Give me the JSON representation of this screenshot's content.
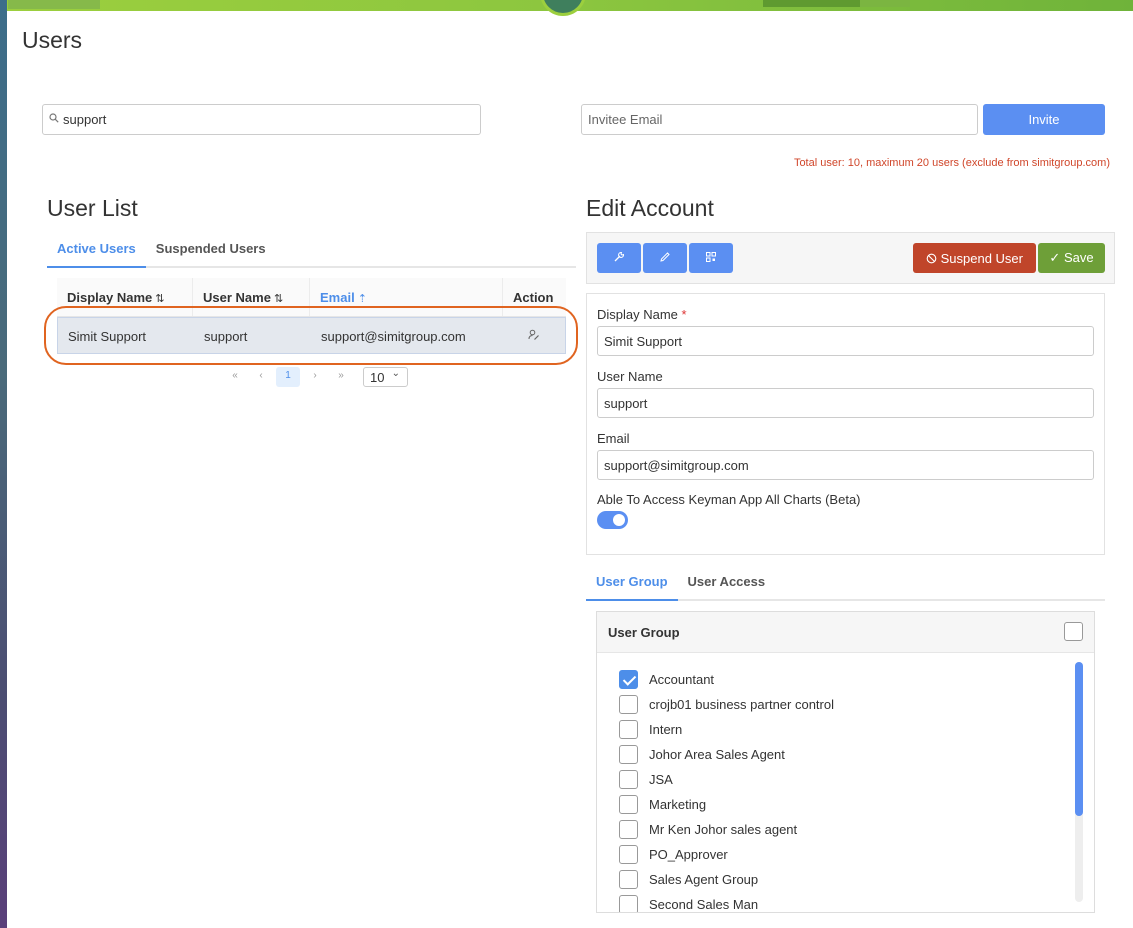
{
  "page": {
    "title": "Users"
  },
  "search": {
    "value": "support",
    "placeholder": "Search"
  },
  "invite": {
    "placeholder": "Invitee Email",
    "button_label": "Invite"
  },
  "total_note": "Total user: 10, maximum 20 users (exclude from simitgroup.com)",
  "user_list": {
    "title": "User List",
    "tabs": [
      {
        "label": "Active Users"
      },
      {
        "label": "Suspended Users"
      }
    ],
    "columns": [
      "Display Name",
      "User Name",
      "Email",
      "Action"
    ],
    "rows": [
      {
        "display_name": "Simit Support",
        "user_name": "support",
        "email": "support@simitgroup.com",
        "action_icon": "user-edit-icon"
      }
    ],
    "pagination": {
      "first": "«",
      "prev": "‹",
      "current": "1",
      "next": "›",
      "last": "»",
      "page_size": "10"
    }
  },
  "edit_account": {
    "title": "Edit Account",
    "toolbar": {
      "icons": [
        "wrench-icon",
        "pencil-icon",
        "qr-code-icon"
      ],
      "suspend_label": "Suspend User",
      "save_label": "Save"
    },
    "form": {
      "display_name_label": "Display Name",
      "display_name_required": "*",
      "display_name_value": "Simit Support",
      "user_name_label": "User Name",
      "user_name_value": "support",
      "email_label": "Email",
      "email_value": "support@simitgroup.com",
      "access_label": "Able To Access Keyman App All Charts (Beta)",
      "access_enabled": true
    },
    "tabs": [
      {
        "label": "User Group"
      },
      {
        "label": "User Access"
      }
    ],
    "user_group": {
      "title": "User Group",
      "items": [
        {
          "label": "Accountant",
          "checked": true
        },
        {
          "label": "crojb01 business partner control",
          "checked": false
        },
        {
          "label": "Intern",
          "checked": false
        },
        {
          "label": "Johor Area Sales Agent",
          "checked": false
        },
        {
          "label": "JSA",
          "checked": false
        },
        {
          "label": "Marketing",
          "checked": false
        },
        {
          "label": "Mr Ken Johor sales agent",
          "checked": false
        },
        {
          "label": "PO_Approver",
          "checked": false
        },
        {
          "label": "Sales Agent Group",
          "checked": false
        },
        {
          "label": "Second Sales Man",
          "checked": false
        }
      ]
    }
  },
  "colors": {
    "accent": "#5b8ff2",
    "danger": "#c0452a",
    "success": "#6e9f38",
    "highlight": "#e06420",
    "note": "#d0462a"
  }
}
